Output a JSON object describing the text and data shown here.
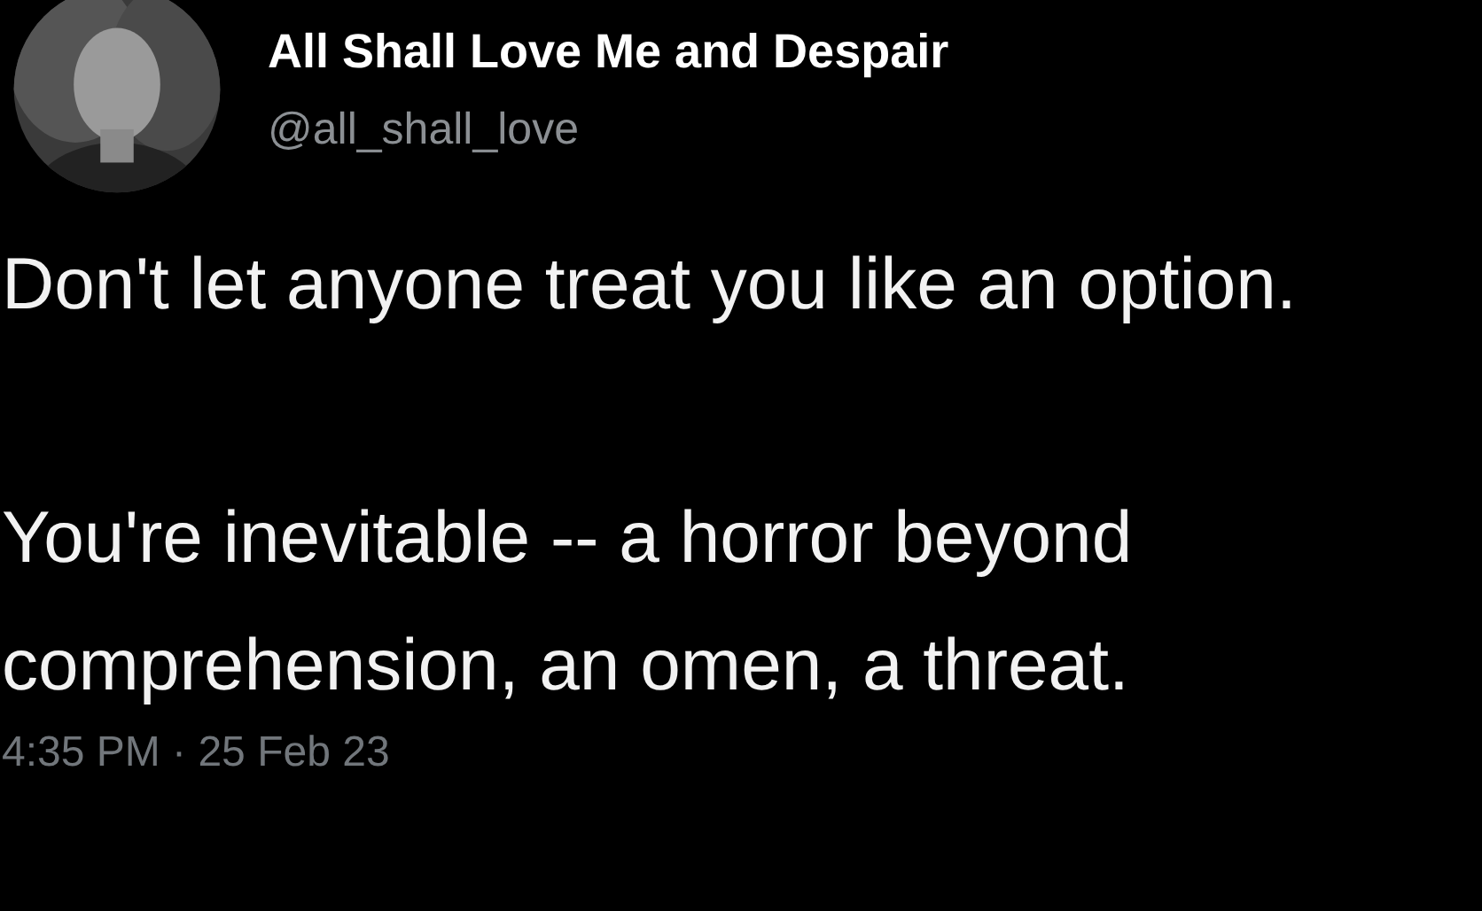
{
  "author": {
    "name": "All Shall Love Me and Despair",
    "handle": "@all_shall_love"
  },
  "body": [
    "Don't let anyone treat you like an option.",
    "You're inevitable -- a horror beyond comprehension, an omen, a threat."
  ],
  "timestamp": "4:35 PM · 25 Feb 23"
}
